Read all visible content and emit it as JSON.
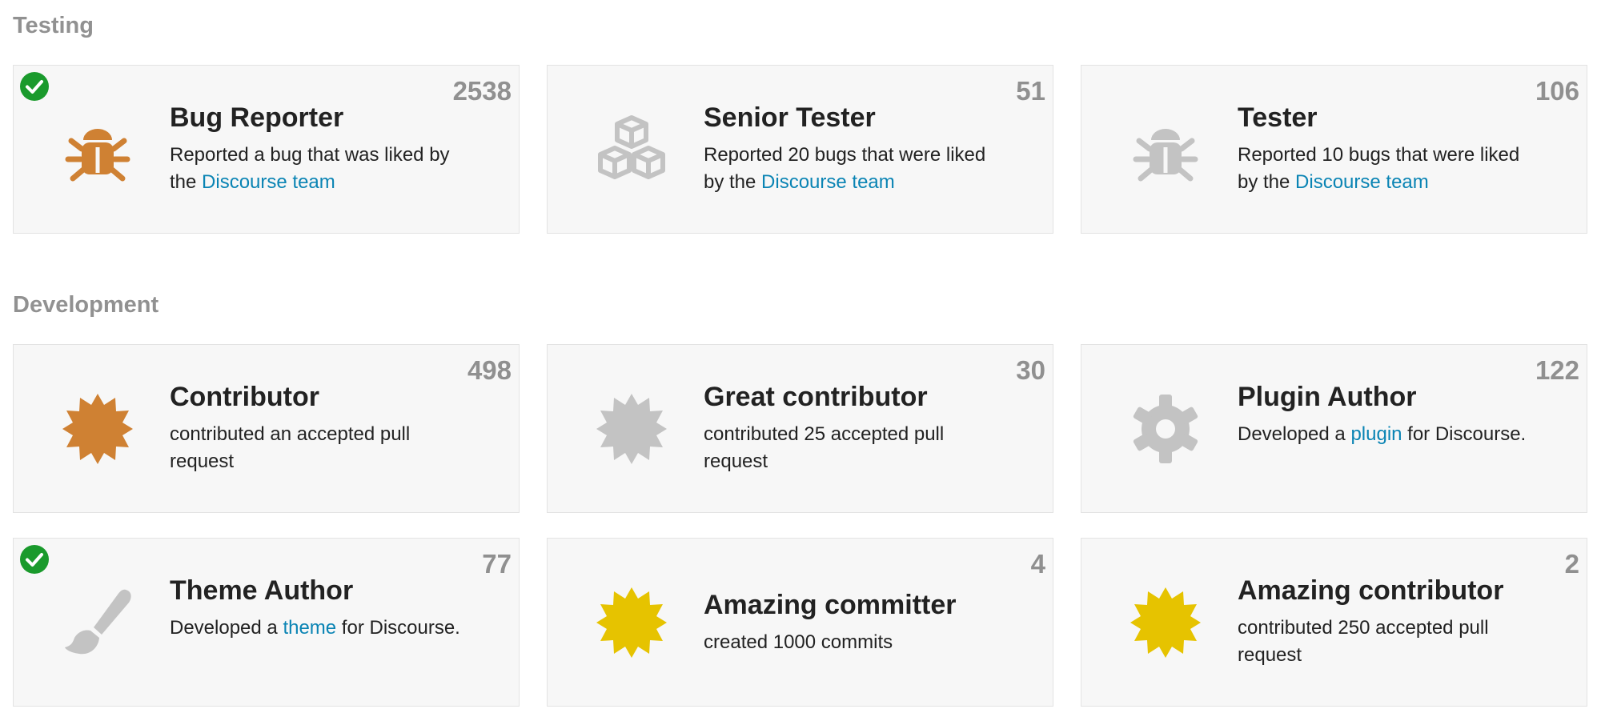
{
  "colors": {
    "earned": "#cf8133",
    "unearned": "#c3c3c3",
    "gold": "#e6c300",
    "check": "#1a9a2c",
    "link": "#0a84b4"
  },
  "sections": [
    {
      "title": "Testing",
      "badges": [
        {
          "name": "Bug Reporter",
          "count": "2538",
          "icon": "bug-icon",
          "granted": true,
          "desc_before": "Reported a bug that was liked by the ",
          "link": "Discourse team",
          "desc_after": ""
        },
        {
          "name": "Senior Tester",
          "count": "51",
          "icon": "cubes-icon",
          "granted": false,
          "desc_before": "Reported 20 bugs that were liked by the ",
          "link": "Discourse team",
          "desc_after": ""
        },
        {
          "name": "Tester",
          "count": "106",
          "icon": "bug-icon",
          "granted": false,
          "desc_before": "Reported 10 bugs that were liked by the ",
          "link": "Discourse team",
          "desc_after": ""
        }
      ]
    },
    {
      "title": "Development",
      "badges": [
        {
          "name": "Contributor",
          "count": "498",
          "icon": "certificate-icon",
          "granted": false,
          "desc_before": "contributed an accepted pull request",
          "link": "",
          "desc_after": ""
        },
        {
          "name": "Great contributor",
          "count": "30",
          "icon": "certificate-icon",
          "granted": false,
          "desc_before": "contributed 25 accepted pull request",
          "link": "",
          "desc_after": ""
        },
        {
          "name": "Plugin Author",
          "count": "122",
          "icon": "cog-icon",
          "granted": false,
          "desc_before": "Developed a ",
          "link": "plugin",
          "desc_after": " for Discourse."
        },
        {
          "name": "Theme Author",
          "count": "77",
          "icon": "paintbrush-icon",
          "granted": true,
          "desc_before": "Developed a ",
          "link": "theme",
          "desc_after": " for Discourse."
        },
        {
          "name": "Amazing committer",
          "count": "4",
          "icon": "certificate-icon",
          "granted": false,
          "desc_before": "created 1000 commits",
          "link": "",
          "desc_after": ""
        },
        {
          "name": "Amazing contributor",
          "count": "2",
          "icon": "certificate-icon",
          "granted": false,
          "desc_before": "contributed 250 accepted pull request",
          "link": "",
          "desc_after": ""
        }
      ]
    }
  ]
}
